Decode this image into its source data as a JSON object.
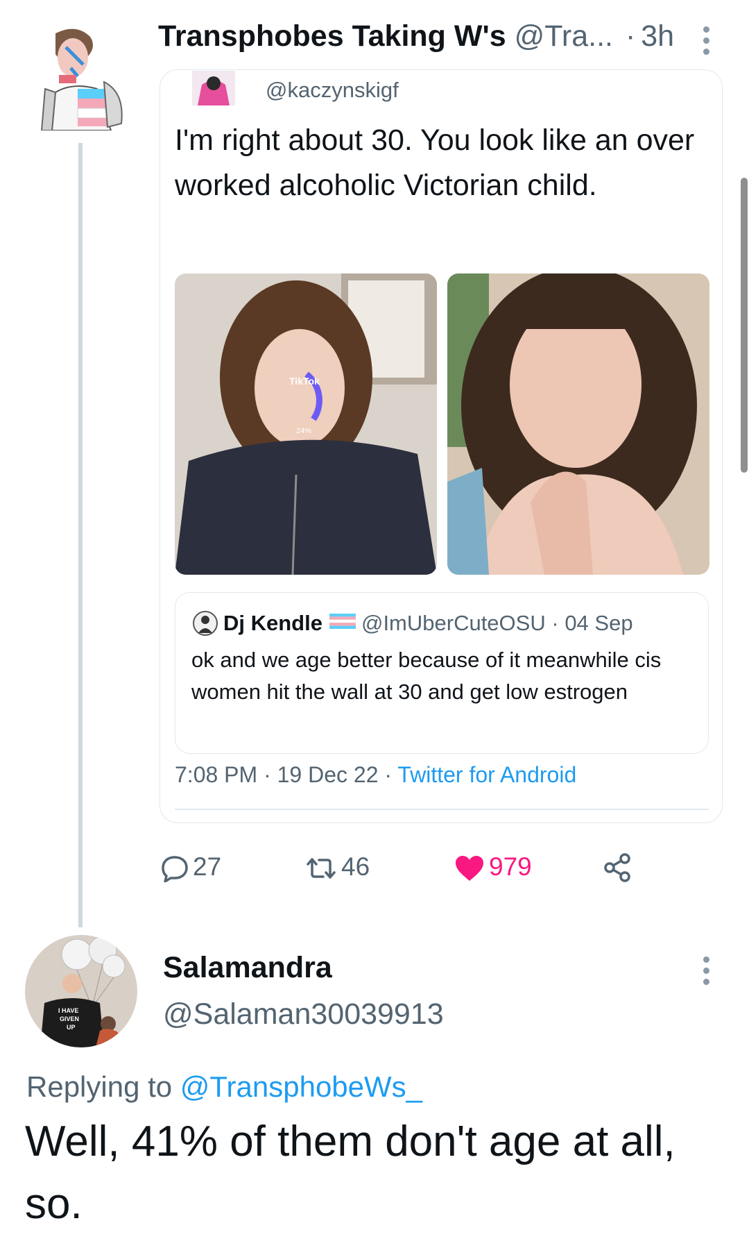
{
  "tweet1": {
    "author_name": "Transphobes Taking W's",
    "author_handle": "@Tra...",
    "dot": "·",
    "time": "3h",
    "quoted": {
      "handle": "@kaczynskigf",
      "body": "I'm right about 30. You look like an over worked alcoholic Victorian child.",
      "photo1_overlay": "TikTok",
      "photo1_progress": "24%",
      "inner_quote": {
        "name": "Dj Kendle",
        "handle": "@ImUberCuteOSU",
        "dot": "·",
        "date": "04 Sep",
        "body": "ok and we age better because of it meanwhile cis women hit the wall at 30 and get low estrogen"
      },
      "meta_time": "7:08 PM",
      "meta_date": "19 Dec 22",
      "meta_sep": "·",
      "meta_source": "Twitter for Android"
    },
    "actions": {
      "replies": "27",
      "retweets": "46",
      "likes": "979"
    }
  },
  "tweet2": {
    "author_name": "Salamandra",
    "author_handle": "@Salaman30039913",
    "replying_prefix": "Replying to",
    "replying_to": "@TransphobeWs_",
    "body": "Well, 41% of them don't age at all, so.",
    "avatar_shirt_text": [
      "I HAVE",
      "GIVEN",
      "UP"
    ]
  },
  "colors": {
    "text": "#0f1419",
    "secondary": "#536471",
    "link": "#1d9bf0",
    "like": "#f91880",
    "border": "#e1e8ed"
  },
  "icons": [
    "reply-icon",
    "retweet-icon",
    "like-icon",
    "share-icon",
    "more-icon",
    "trans-flag-icon"
  ]
}
